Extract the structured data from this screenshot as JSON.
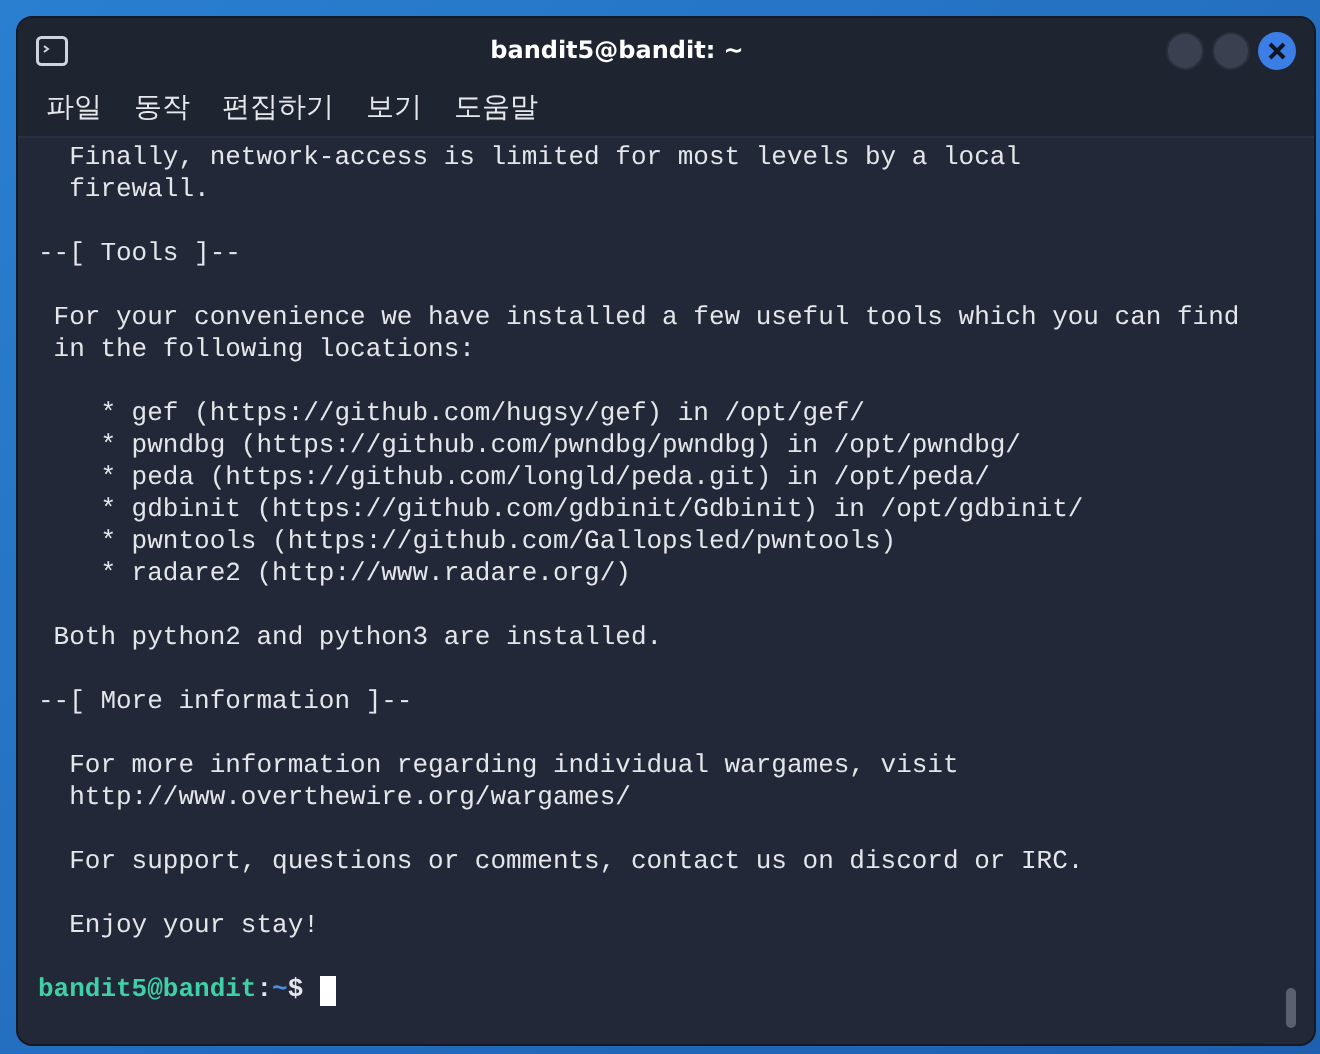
{
  "window": {
    "title": "bandit5@bandit: ~"
  },
  "menu": [
    {
      "label": "파일"
    },
    {
      "label": "동작"
    },
    {
      "label": "편집하기"
    },
    {
      "label": "보기"
    },
    {
      "label": "도움말"
    }
  ],
  "terminal": {
    "blocks": [
      [
        "  Finally, network-access is limited for most levels by a local",
        "  firewall."
      ],
      [
        "--[ Tools ]--"
      ],
      [
        " For your convenience we have installed a few useful tools which you can find",
        " in the following locations:"
      ],
      [
        "    * gef (https://github.com/hugsy/gef) in /opt/gef/",
        "    * pwndbg (https://github.com/pwndbg/pwndbg) in /opt/pwndbg/",
        "    * peda (https://github.com/longld/peda.git) in /opt/peda/",
        "    * gdbinit (https://github.com/gdbinit/Gdbinit) in /opt/gdbinit/",
        "    * pwntools (https://github.com/Gallopsled/pwntools)",
        "    * radare2 (http://www.radare.org/)"
      ],
      [
        " Both python2 and python3 are installed."
      ],
      [
        "--[ More information ]--"
      ],
      [
        "  For more information regarding individual wargames, visit",
        "  http://www.overthewire.org/wargames/"
      ],
      [
        "  For support, questions or comments, contact us on discord or IRC."
      ],
      [
        "  Enjoy your stay!"
      ]
    ],
    "prompt": {
      "user_host": "bandit5@bandit",
      "separator": ":",
      "path": "~",
      "symbol": "$"
    }
  }
}
